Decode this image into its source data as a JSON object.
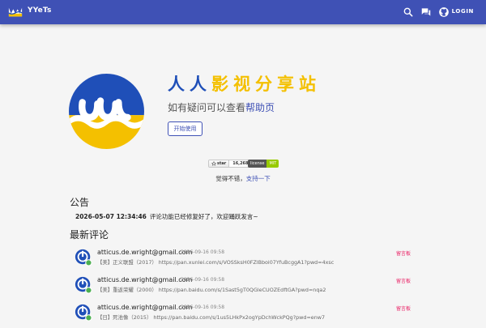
{
  "appbar": {
    "title": "YYeTs",
    "login_label": "LOGIN",
    "icons": [
      "search-icon",
      "chat-icon",
      "github-icon"
    ],
    "color": "#3f51b5"
  },
  "hero": {
    "title_part1": "人人",
    "title_part2": "影视分享站",
    "subtitle_prefix": "如有疑问可以查看",
    "subtitle_link": "帮助页",
    "start_button": "开始使用"
  },
  "badges": {
    "star_label": "star",
    "star_count": "16,268",
    "license_label": "license",
    "license_value": "MIT"
  },
  "support": {
    "prefix": "觉得不错，",
    "link": "支持一下"
  },
  "announcement": {
    "heading": "公告",
    "date": "2026-05-07 12:34:46",
    "text": "评论功能已经修复好了，欢迎踊跃发言~"
  },
  "comments": {
    "heading": "最新评论",
    "items": [
      {
        "email": "atticus.de.wright@gmail.com",
        "time": "2026-09-16 09:58",
        "board": "留言板",
        "text": "【美】正义联盟（2017） https://pan.xunlei.com/s/VOSSksH0FZlBboi07YfuBcggA1?pwd=4xsc"
      },
      {
        "email": "atticus.de.wright@gmail.com",
        "time": "2026-09-16 09:58",
        "board": "留言板",
        "text": "【美】重返荣耀（2000） https://pan.baidu.com/s/1Sast5gT0QGleCUOZEdftGA?pwd=nqa2"
      },
      {
        "email": "atticus.de.wright@gmail.com",
        "time": "2026-09-16 09:58",
        "board": "留言板",
        "text": "【日】死池像（2015） https://pan.baidu.com/s/1us5LHkPx2ogYpDchWckPQg?pwd=enw7"
      }
    ]
  },
  "colors": {
    "brand_blue": "#3f51b5",
    "logo_blue": "#1f4fb8",
    "logo_yellow": "#f4c000",
    "board_pink": "#e91e63",
    "online_green": "#4caf50"
  }
}
